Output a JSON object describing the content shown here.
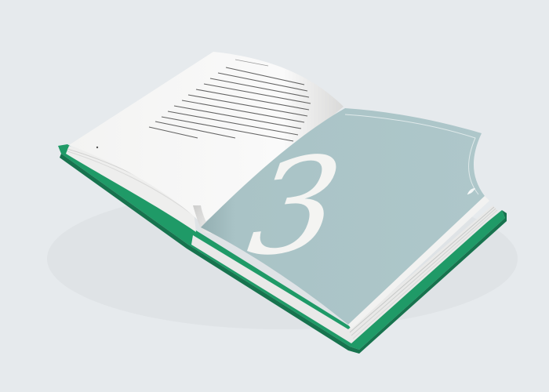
{
  "scene": {
    "subject": "open-hardcover-book-mockup",
    "colors": {
      "background": "#e6eaed",
      "cover_green": "#1f9a67",
      "cover_green_dark": "#17734e",
      "page_white": "#f7f7f6",
      "page_shadow": "#dcdcdb",
      "page_edge": "#cfd1d0",
      "chapter_page": "#a9c3c6",
      "numeral": "#f4f4f2",
      "body_text": "#3c3c3c"
    }
  },
  "right_page": {
    "chapter_numeral": "3"
  },
  "icons": {
    "page_mark": "small-leaf-glyph"
  }
}
